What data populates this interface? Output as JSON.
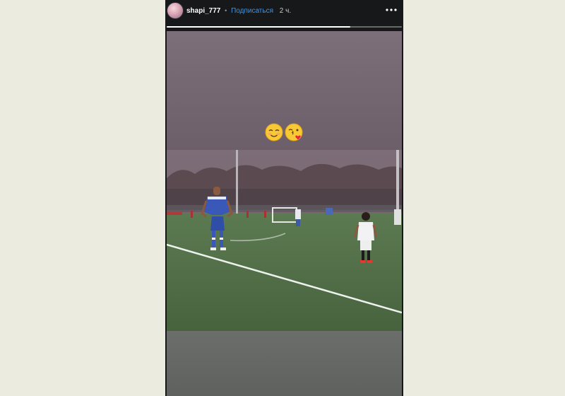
{
  "story": {
    "username": "shapi_777",
    "separator": "•",
    "follow_label": "Подписаться",
    "time_ago": "2 ч.",
    "progress": 0.78,
    "menu_icon": "more-horizontal-icon",
    "avatar_icon": "profile-avatar",
    "stickers": [
      "smiling-face-emoji",
      "face-blowing-kiss-emoji"
    ]
  },
  "colors": {
    "background": "#ebebdf",
    "story_chrome": "#17181a",
    "follow_link": "#3897f0"
  }
}
